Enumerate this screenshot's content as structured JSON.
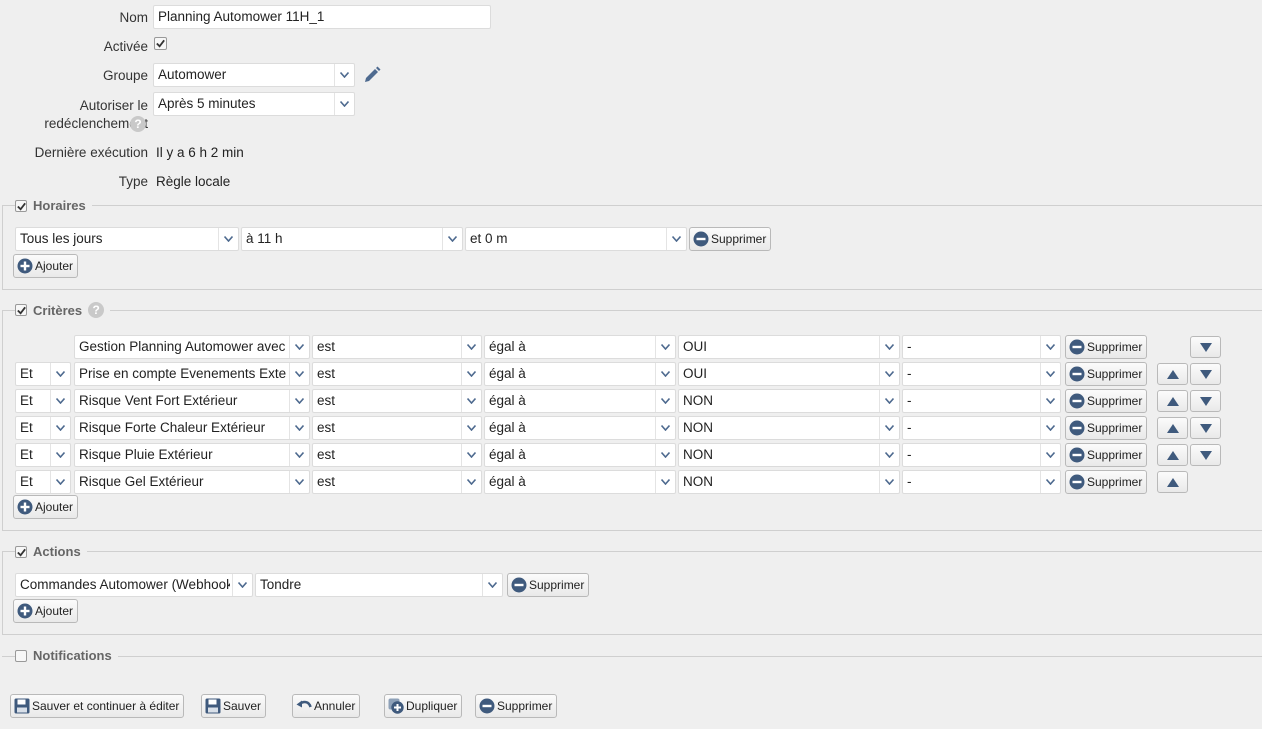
{
  "form": {
    "name_label": "Nom",
    "name_value": "Planning Automower 11H_1",
    "enabled_label": "Activée",
    "group_label": "Groupe",
    "group_value": "Automower",
    "retrigger_label_1": "Autoriser le",
    "retrigger_label_2": "redéclenchement",
    "retrigger_value": "Après 5 minutes",
    "last_exec_label": "Dernière exécution",
    "last_exec_value": "Il y a 6 h 2 min",
    "type_label": "Type",
    "type_value": "Règle locale"
  },
  "schedules": {
    "legend": "Horaires",
    "day": "Tous les jours",
    "hour": "à 11 h",
    "minute": "et 0 m",
    "delete_label": "Supprimer",
    "add_label": "Ajouter"
  },
  "criteria": {
    "legend": "Critères",
    "delete_label": "Supprimer",
    "add_label": "Ajouter",
    "rows": [
      {
        "conj": "",
        "field": "Gestion Planning Automower avec",
        "op": "est",
        "cmp": "égal à",
        "value": "OUI",
        "extra": "-"
      },
      {
        "conj": "Et",
        "field": "Prise en compte Evenements Exter",
        "op": "est",
        "cmp": "égal à",
        "value": "OUI",
        "extra": "-"
      },
      {
        "conj": "Et",
        "field": "Risque Vent Fort Extérieur",
        "op": "est",
        "cmp": "égal à",
        "value": "NON",
        "extra": "-"
      },
      {
        "conj": "Et",
        "field": "Risque Forte Chaleur Extérieur",
        "op": "est",
        "cmp": "égal à",
        "value": "NON",
        "extra": "-"
      },
      {
        "conj": "Et",
        "field": "Risque Pluie Extérieur",
        "op": "est",
        "cmp": "égal à",
        "value": "NON",
        "extra": "-"
      },
      {
        "conj": "Et",
        "field": "Risque Gel Extérieur",
        "op": "est",
        "cmp": "égal à",
        "value": "NON",
        "extra": "-"
      }
    ]
  },
  "actions": {
    "legend": "Actions",
    "target": "Commandes Automower (Webhook",
    "command": "Tondre",
    "delete_label": "Supprimer",
    "add_label": "Ajouter"
  },
  "notifications": {
    "legend": "Notifications"
  },
  "footer": {
    "save_continue": "Sauver et continuer à éditer",
    "save": "Sauver",
    "cancel": "Annuler",
    "duplicate": "Dupliquer",
    "delete": "Supprimer"
  }
}
